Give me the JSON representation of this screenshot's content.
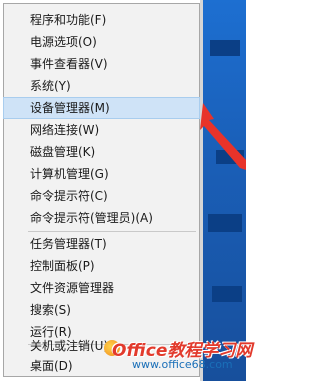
{
  "menu": {
    "items": [
      {
        "label": "程序和功能(F)"
      },
      {
        "label": "电源选项(O)"
      },
      {
        "label": "事件查看器(V)"
      },
      {
        "label": "系统(Y)"
      },
      {
        "label": "设备管理器(M)",
        "highlighted": true
      },
      {
        "label": "网络连接(W)"
      },
      {
        "label": "磁盘管理(K)"
      },
      {
        "label": "计算机管理(G)"
      },
      {
        "label": "命令提示符(C)"
      },
      {
        "label": "命令提示符(管理员)(A)"
      },
      {
        "label": "任务管理器(T)"
      },
      {
        "label": "控制面板(P)"
      },
      {
        "label": "文件资源管理器"
      },
      {
        "label": "搜索(S)"
      },
      {
        "label": "运行(R)"
      },
      {
        "label": "关机或注销(U)"
      },
      {
        "label": "桌面(D)"
      }
    ]
  },
  "watermark": {
    "title": "Office教程学习网",
    "url": "www.office68.com"
  },
  "colors": {
    "highlight": "#cfe3f7",
    "arrow": "#e8332a",
    "desktop": "#1a5fb8"
  }
}
